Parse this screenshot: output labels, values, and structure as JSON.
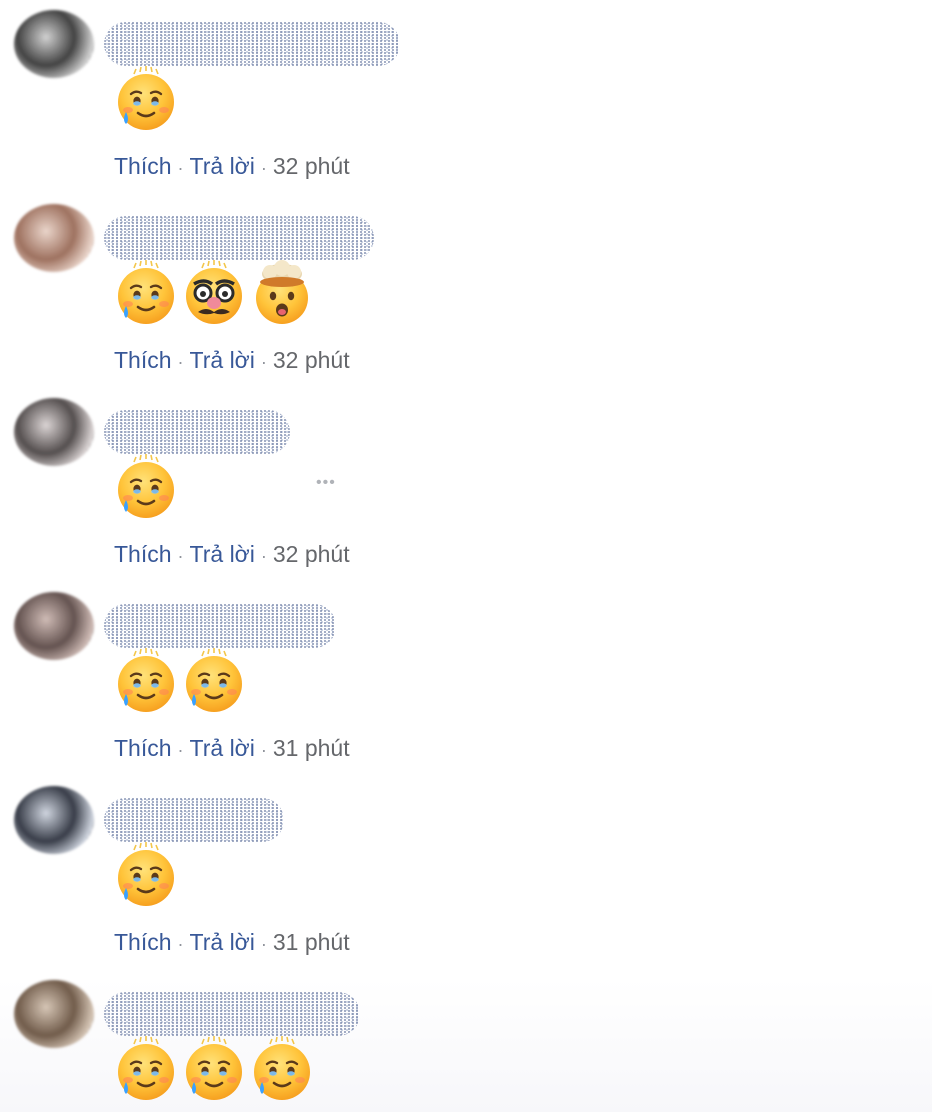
{
  "comments": [
    {
      "avatar_colors": [
        "#3a3a3a",
        "#cfcfcf"
      ],
      "emojis": [
        "holding-back-tears-emoji"
      ],
      "actions": {
        "like": "Thích",
        "reply": "Trả lời",
        "time": "32 phút"
      }
    },
    {
      "avatar_colors": [
        "#9a6b58",
        "#e9d3c8"
      ],
      "emojis": [
        "holding-back-tears-emoji",
        "disguised-face-emoji",
        "exploding-head-emoji"
      ],
      "actions": {
        "like": "Thích",
        "reply": "Trả lời",
        "time": "32 phút"
      }
    },
    {
      "avatar_colors": [
        "#4c4646",
        "#d9d2d2"
      ],
      "emojis": [
        "holding-back-tears-emoji"
      ],
      "actions": {
        "like": "Thích",
        "reply": "Trả lời",
        "time": "32 phút"
      },
      "more_label": "•••"
    },
    {
      "avatar_colors": [
        "#5d4b48",
        "#cdb8b2"
      ],
      "emojis": [
        "holding-back-tears-emoji",
        "holding-back-tears-emoji"
      ],
      "actions": {
        "like": "Thích",
        "reply": "Trả lời",
        "time": "31 phút"
      }
    },
    {
      "avatar_colors": [
        "#2f3440",
        "#cdd3de"
      ],
      "emojis": [
        "holding-back-tears-emoji"
      ],
      "actions": {
        "like": "Thích",
        "reply": "Trả lời",
        "time": "31 phút"
      }
    },
    {
      "avatar_colors": [
        "#6a5442",
        "#d4c3b2"
      ],
      "emojis": [
        "holding-back-tears-emoji",
        "holding-back-tears-emoji",
        "holding-back-tears-emoji"
      ],
      "actions": null
    }
  ],
  "colors": {
    "link": "#385898",
    "meta": "#65676b"
  }
}
